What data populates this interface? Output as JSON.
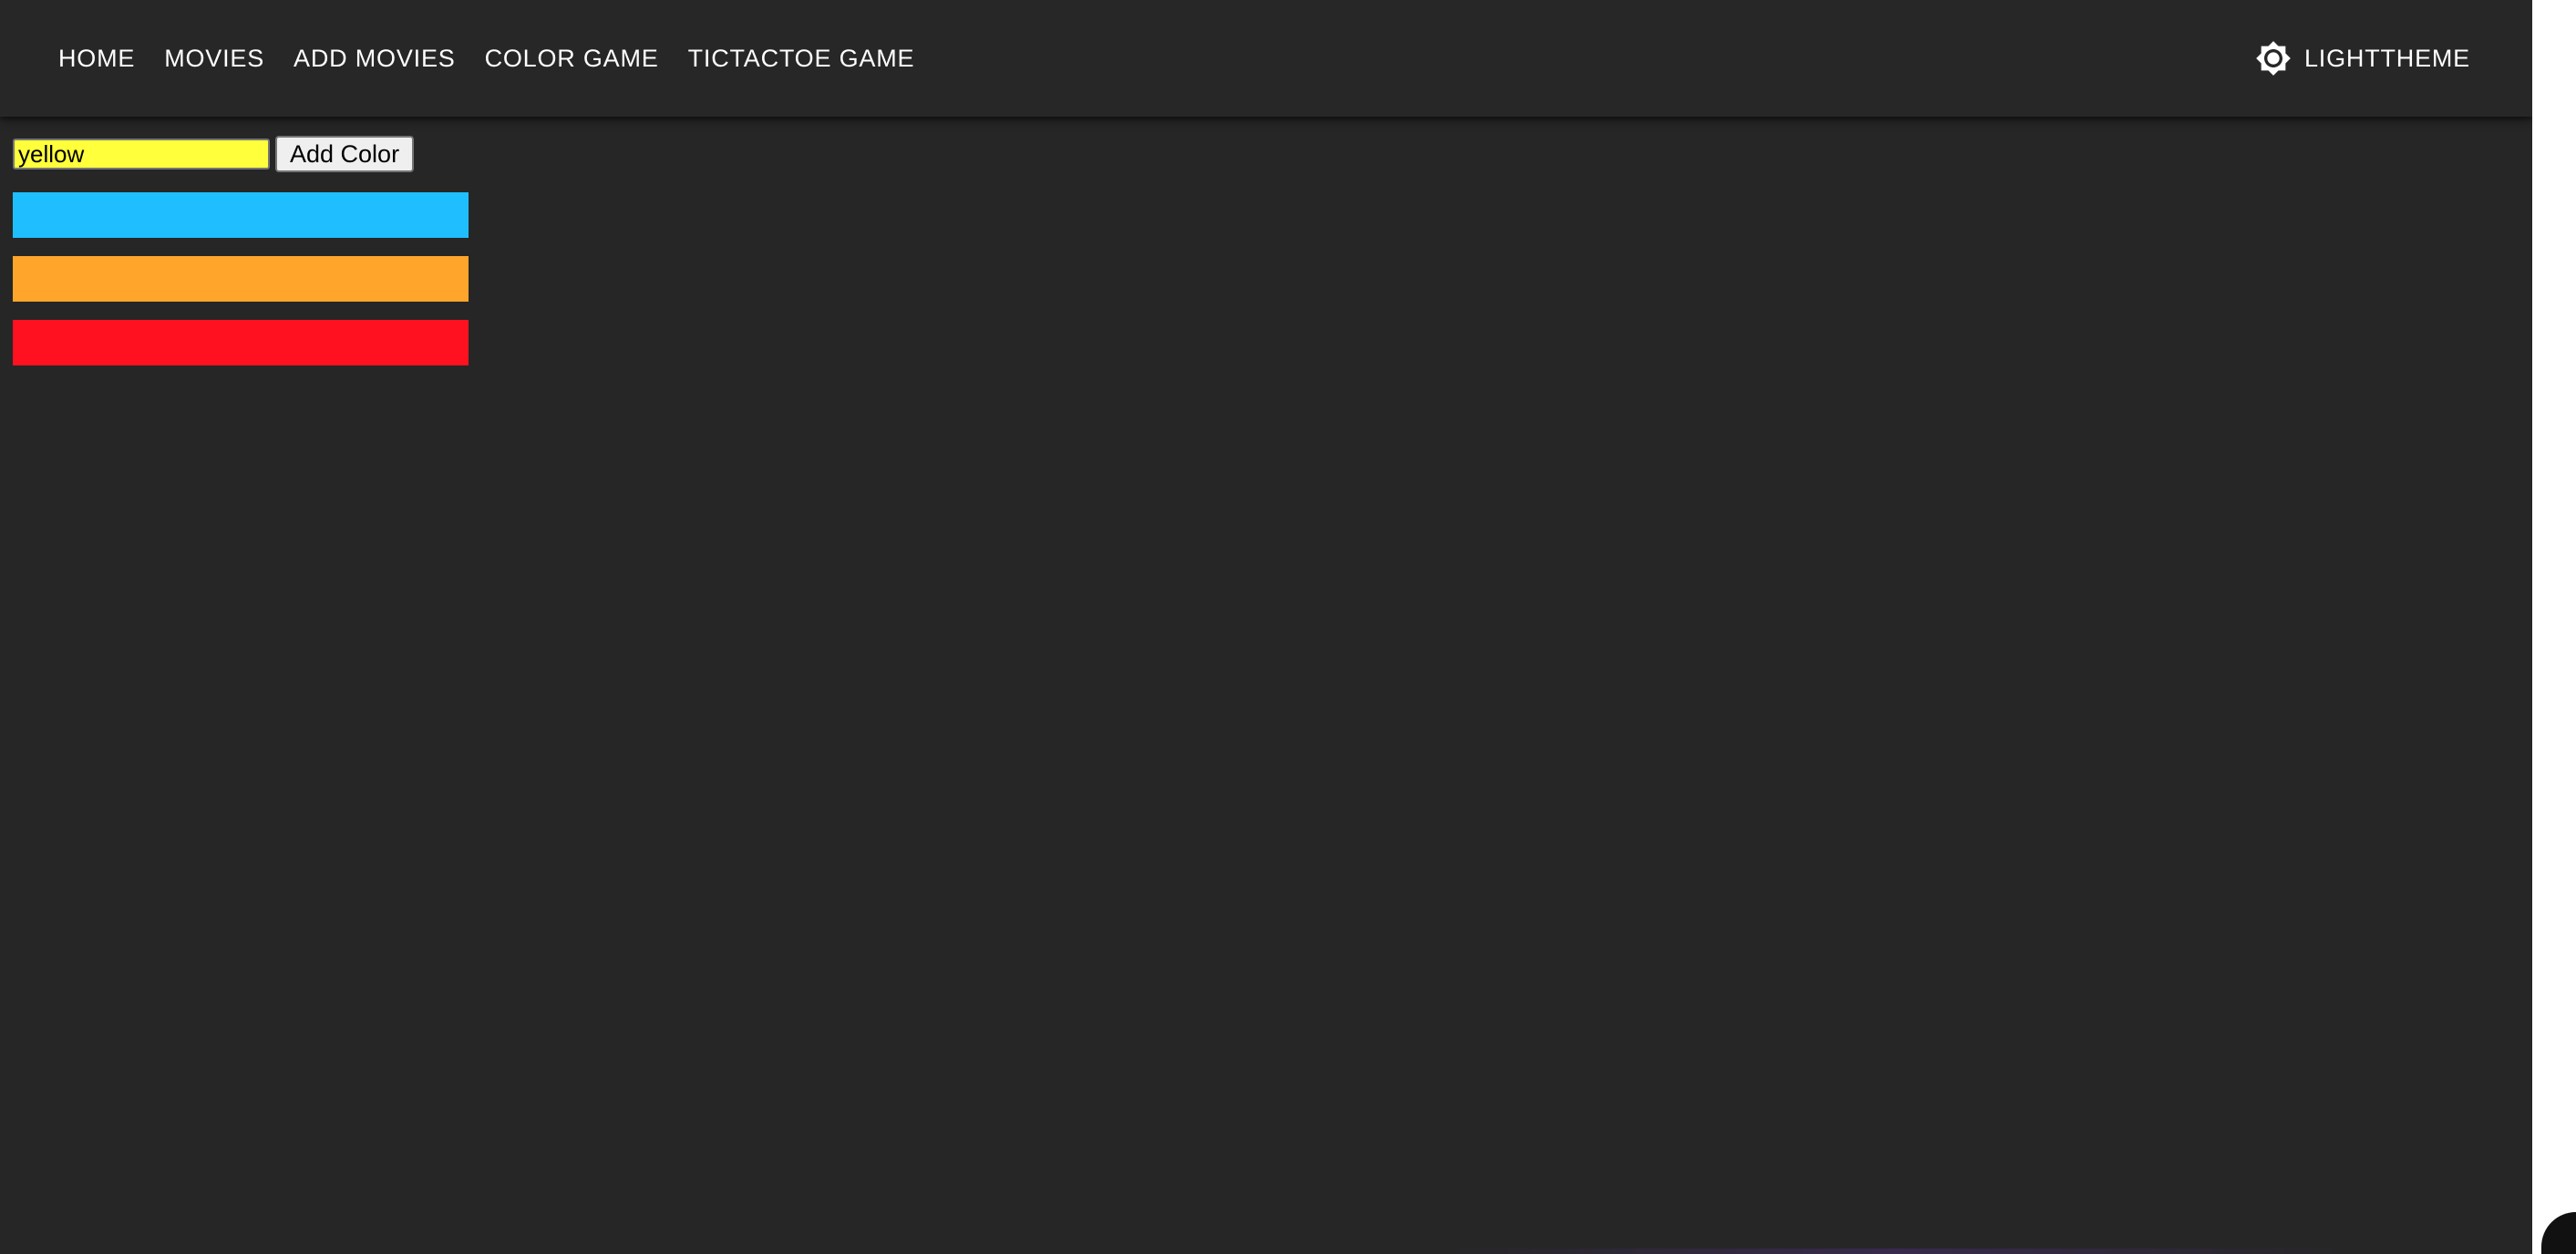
{
  "nav": {
    "items": [
      {
        "label": "HOME"
      },
      {
        "label": "MOVIES"
      },
      {
        "label": "ADD MOVIES"
      },
      {
        "label": "COLOR GAME"
      },
      {
        "label": "TICTACTOE GAME"
      }
    ],
    "theme_label": "LIGHTTHEME",
    "theme_icon": "brightness-icon"
  },
  "color_game": {
    "input_value": "yellow",
    "add_button_label": "Add Color",
    "colors": [
      "deepskyblue",
      "orange",
      "red"
    ]
  },
  "palette": {
    "background": "#262626",
    "appbar": "#272727",
    "input_bg": "#ffff3b",
    "box_colors": [
      "#1fbfff",
      "#ffa52b",
      "#ff111f"
    ]
  }
}
